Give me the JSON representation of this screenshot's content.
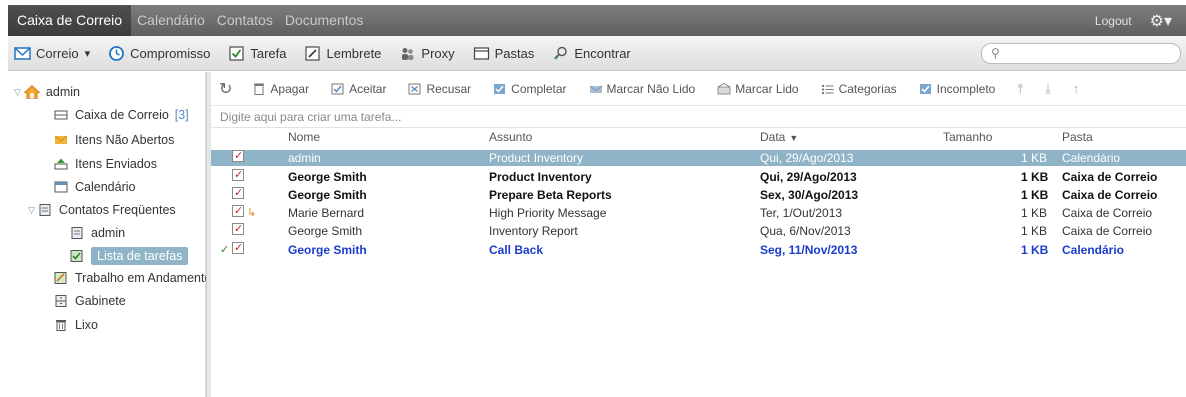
{
  "nav": {
    "tabs": [
      "Caixa de Correio",
      "Calendário",
      "Contatos",
      "Documentos"
    ],
    "logout": "Logout"
  },
  "toolbar": {
    "items": [
      "Correio",
      "Compromisso",
      "Tarefa",
      "Lembrete",
      "Proxy",
      "Pastas",
      "Encontrar"
    ],
    "mail_dropdown": "▾",
    "search_placeholder": ""
  },
  "sidebar": {
    "root": "admin",
    "items": [
      "Caixa de Correio",
      "Itens Não Abertos",
      "Itens Enviados",
      "Calendário",
      "Contatos Freqüentes",
      "admin",
      "Lista de tarefas",
      "Trabalho em Andamento",
      "Gabinete",
      "Lixo"
    ],
    "inbox_count": "[3]"
  },
  "actions": [
    "Apagar",
    "Aceitar",
    "Recusar",
    "Completar",
    "Marcar Não Lido",
    "Marcar Lido",
    "Categorias",
    "Incompleto"
  ],
  "quick_entry": "Digite aqui para criar uma tarefa...",
  "columns": [
    "Nome",
    "Assunto",
    "Data",
    "Tamanho",
    "Pasta"
  ],
  "rows": [
    {
      "name": "admin",
      "subject": "Product Inventory",
      "date": "Qui, 29/Ago/2013",
      "size": "1 KB",
      "folder": "Calendário"
    },
    {
      "name": "George Smith",
      "subject": "Product Inventory",
      "date": "Qui, 29/Ago/2013",
      "size": "1 KB",
      "folder": "Caixa de Correio"
    },
    {
      "name": "George Smith",
      "subject": "Prepare Beta Reports",
      "date": "Sex, 30/Ago/2013",
      "size": "1 KB",
      "folder": "Caixa de Correio"
    },
    {
      "name": "Marie Bernard",
      "subject": "High Priority Message",
      "date": "Ter, 1/Out/2013",
      "size": "1 KB",
      "folder": "Caixa de Correio"
    },
    {
      "name": "George Smith",
      "subject": "Inventory Report",
      "date": "Qua, 6/Nov/2013",
      "size": "1 KB",
      "folder": "Caixa de Correio"
    },
    {
      "name": "George Smith",
      "subject": "Call Back",
      "date": "Seg, 11/Nov/2013",
      "size": "1 KB",
      "folder": "Calendário"
    }
  ],
  "colors": {
    "nav_bg": "#6b6b6b",
    "selected": "#8fb3c7",
    "accent_blue": "#1a3ccc",
    "check_red": "#c0282a"
  }
}
